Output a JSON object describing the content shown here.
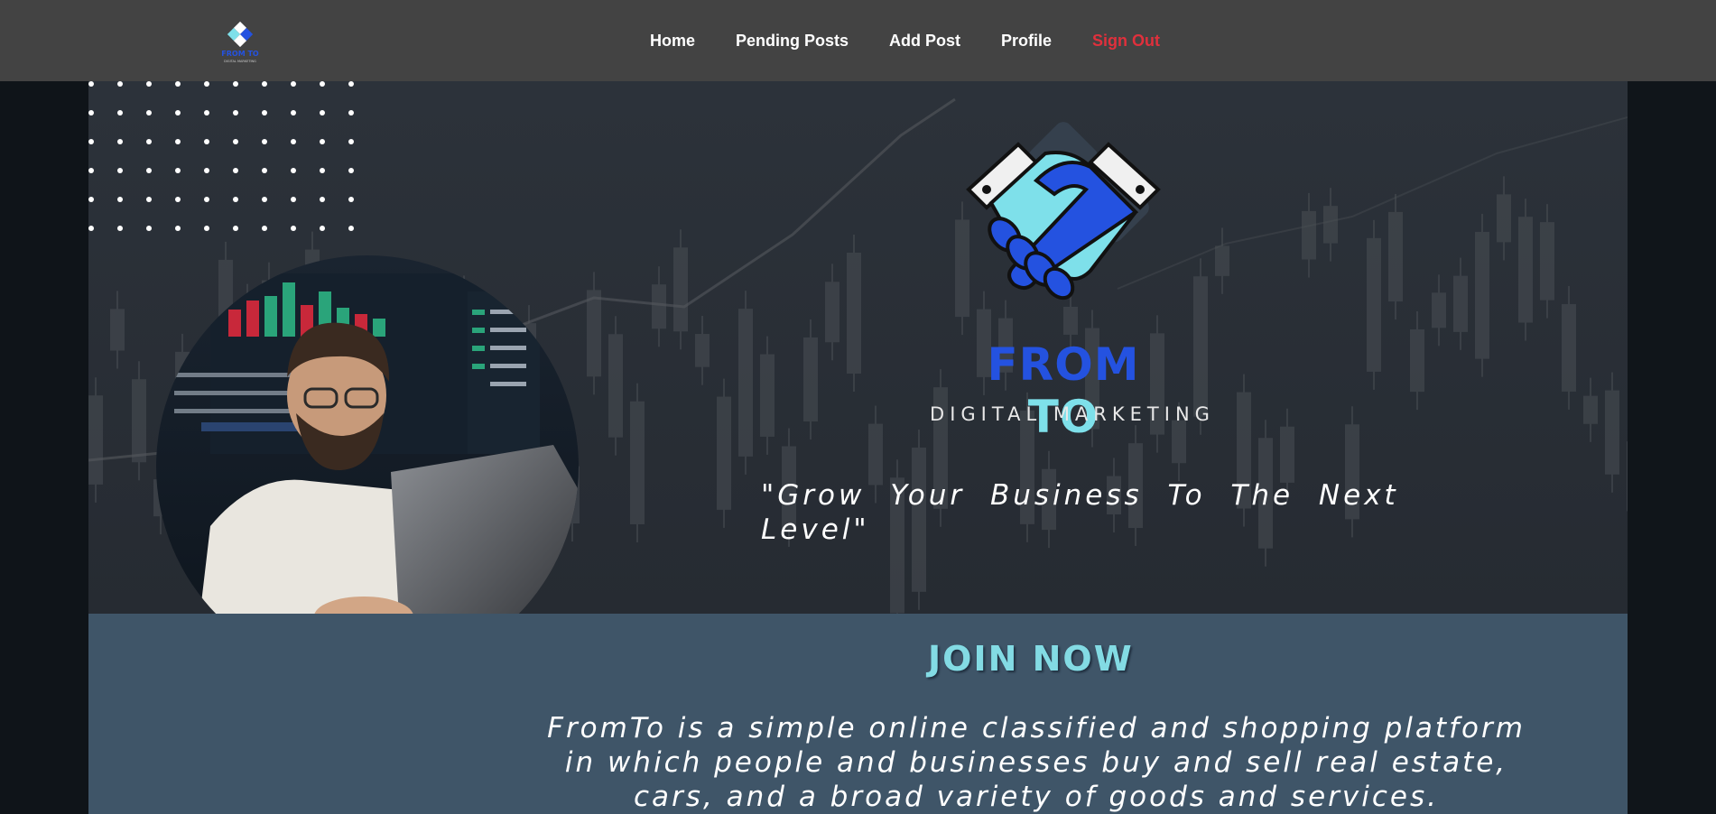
{
  "nav": {
    "logo_alt": "FROM TO",
    "links": [
      {
        "label": "Home"
      },
      {
        "label": "Pending Posts"
      },
      {
        "label": "Add Post"
      },
      {
        "label": "Profile"
      },
      {
        "label": "Sign Out",
        "color": "#e0303c"
      }
    ]
  },
  "hero": {
    "brand_from": "FROM",
    "brand_to": "TO",
    "brand_subtitle": "DIGITAL MARKETING",
    "tagline": "\"Grow Your Business To The Next Level\""
  },
  "join": {
    "title": "JOIN NOW",
    "description": "FromTo is a simple online classified and shopping platform in which people and businesses buy and sell real estate, cars, and a broad variety of goods and services."
  },
  "colors": {
    "navbar_bg": "#434343",
    "hero_bg": "#2a3038",
    "join_bg": "#3f5568",
    "brand_blue": "#2452e0",
    "brand_cyan": "#7ee0ea",
    "signout_red": "#e0303c"
  },
  "icons": {
    "nav_logo": "handshake-logo-icon",
    "brand_logo": "handshake-icon"
  }
}
